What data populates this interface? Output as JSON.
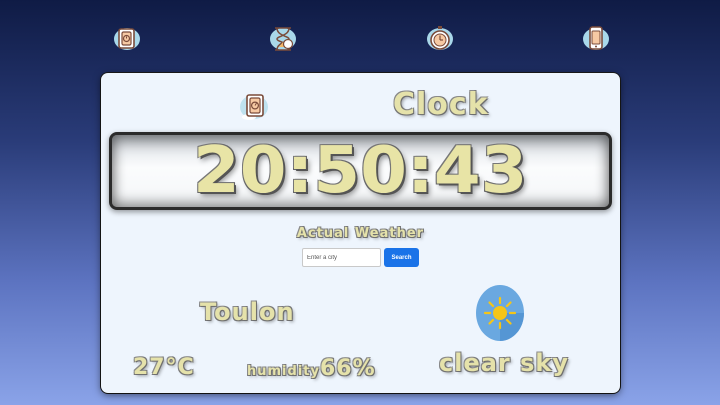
{
  "nav": {
    "items": [
      {
        "icon": "watch-icon"
      },
      {
        "icon": "hourglass-icon"
      },
      {
        "icon": "stopwatch-icon"
      },
      {
        "icon": "phone-icon"
      }
    ]
  },
  "clock": {
    "title": "Clock",
    "time": "20:50:43"
  },
  "weather": {
    "heading": "Actual Weather",
    "search_placeholder": "Enter a city",
    "search_button": "Search",
    "city": "Toulon",
    "temperature": "27°C",
    "humidity_label": "humidity",
    "humidity_value": "66%",
    "description": "clear sky",
    "condition_icon": "sun-icon"
  },
  "colors": {
    "accent_text": "#e5e2aa",
    "search_button": "#1a73e8",
    "card_bg": "#eef5fd"
  }
}
